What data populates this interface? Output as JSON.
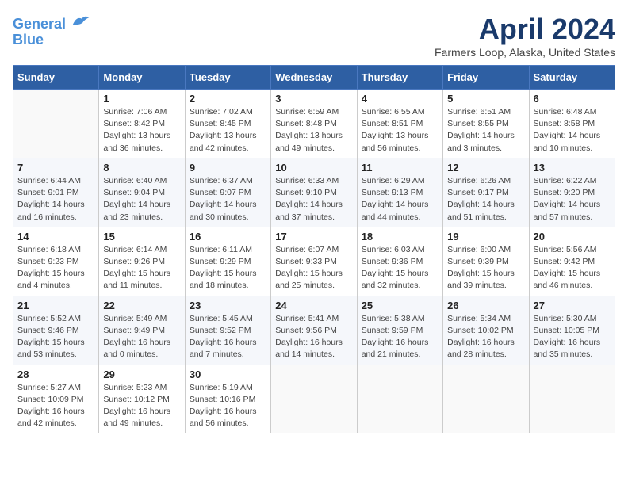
{
  "header": {
    "logo_line1": "General",
    "logo_line2": "Blue",
    "title": "April 2024",
    "location": "Farmers Loop, Alaska, United States"
  },
  "days_of_week": [
    "Sunday",
    "Monday",
    "Tuesday",
    "Wednesday",
    "Thursday",
    "Friday",
    "Saturday"
  ],
  "weeks": [
    [
      {
        "num": "",
        "info": ""
      },
      {
        "num": "1",
        "info": "Sunrise: 7:06 AM\nSunset: 8:42 PM\nDaylight: 13 hours\nand 36 minutes."
      },
      {
        "num": "2",
        "info": "Sunrise: 7:02 AM\nSunset: 8:45 PM\nDaylight: 13 hours\nand 42 minutes."
      },
      {
        "num": "3",
        "info": "Sunrise: 6:59 AM\nSunset: 8:48 PM\nDaylight: 13 hours\nand 49 minutes."
      },
      {
        "num": "4",
        "info": "Sunrise: 6:55 AM\nSunset: 8:51 PM\nDaylight: 13 hours\nand 56 minutes."
      },
      {
        "num": "5",
        "info": "Sunrise: 6:51 AM\nSunset: 8:55 PM\nDaylight: 14 hours\nand 3 minutes."
      },
      {
        "num": "6",
        "info": "Sunrise: 6:48 AM\nSunset: 8:58 PM\nDaylight: 14 hours\nand 10 minutes."
      }
    ],
    [
      {
        "num": "7",
        "info": "Sunrise: 6:44 AM\nSunset: 9:01 PM\nDaylight: 14 hours\nand 16 minutes."
      },
      {
        "num": "8",
        "info": "Sunrise: 6:40 AM\nSunset: 9:04 PM\nDaylight: 14 hours\nand 23 minutes."
      },
      {
        "num": "9",
        "info": "Sunrise: 6:37 AM\nSunset: 9:07 PM\nDaylight: 14 hours\nand 30 minutes."
      },
      {
        "num": "10",
        "info": "Sunrise: 6:33 AM\nSunset: 9:10 PM\nDaylight: 14 hours\nand 37 minutes."
      },
      {
        "num": "11",
        "info": "Sunrise: 6:29 AM\nSunset: 9:13 PM\nDaylight: 14 hours\nand 44 minutes."
      },
      {
        "num": "12",
        "info": "Sunrise: 6:26 AM\nSunset: 9:17 PM\nDaylight: 14 hours\nand 51 minutes."
      },
      {
        "num": "13",
        "info": "Sunrise: 6:22 AM\nSunset: 9:20 PM\nDaylight: 14 hours\nand 57 minutes."
      }
    ],
    [
      {
        "num": "14",
        "info": "Sunrise: 6:18 AM\nSunset: 9:23 PM\nDaylight: 15 hours\nand 4 minutes."
      },
      {
        "num": "15",
        "info": "Sunrise: 6:14 AM\nSunset: 9:26 PM\nDaylight: 15 hours\nand 11 minutes."
      },
      {
        "num": "16",
        "info": "Sunrise: 6:11 AM\nSunset: 9:29 PM\nDaylight: 15 hours\nand 18 minutes."
      },
      {
        "num": "17",
        "info": "Sunrise: 6:07 AM\nSunset: 9:33 PM\nDaylight: 15 hours\nand 25 minutes."
      },
      {
        "num": "18",
        "info": "Sunrise: 6:03 AM\nSunset: 9:36 PM\nDaylight: 15 hours\nand 32 minutes."
      },
      {
        "num": "19",
        "info": "Sunrise: 6:00 AM\nSunset: 9:39 PM\nDaylight: 15 hours\nand 39 minutes."
      },
      {
        "num": "20",
        "info": "Sunrise: 5:56 AM\nSunset: 9:42 PM\nDaylight: 15 hours\nand 46 minutes."
      }
    ],
    [
      {
        "num": "21",
        "info": "Sunrise: 5:52 AM\nSunset: 9:46 PM\nDaylight: 15 hours\nand 53 minutes."
      },
      {
        "num": "22",
        "info": "Sunrise: 5:49 AM\nSunset: 9:49 PM\nDaylight: 16 hours\nand 0 minutes."
      },
      {
        "num": "23",
        "info": "Sunrise: 5:45 AM\nSunset: 9:52 PM\nDaylight: 16 hours\nand 7 minutes."
      },
      {
        "num": "24",
        "info": "Sunrise: 5:41 AM\nSunset: 9:56 PM\nDaylight: 16 hours\nand 14 minutes."
      },
      {
        "num": "25",
        "info": "Sunrise: 5:38 AM\nSunset: 9:59 PM\nDaylight: 16 hours\nand 21 minutes."
      },
      {
        "num": "26",
        "info": "Sunrise: 5:34 AM\nSunset: 10:02 PM\nDaylight: 16 hours\nand 28 minutes."
      },
      {
        "num": "27",
        "info": "Sunrise: 5:30 AM\nSunset: 10:05 PM\nDaylight: 16 hours\nand 35 minutes."
      }
    ],
    [
      {
        "num": "28",
        "info": "Sunrise: 5:27 AM\nSunset: 10:09 PM\nDaylight: 16 hours\nand 42 minutes."
      },
      {
        "num": "29",
        "info": "Sunrise: 5:23 AM\nSunset: 10:12 PM\nDaylight: 16 hours\nand 49 minutes."
      },
      {
        "num": "30",
        "info": "Sunrise: 5:19 AM\nSunset: 10:16 PM\nDaylight: 16 hours\nand 56 minutes."
      },
      {
        "num": "",
        "info": ""
      },
      {
        "num": "",
        "info": ""
      },
      {
        "num": "",
        "info": ""
      },
      {
        "num": "",
        "info": ""
      }
    ]
  ]
}
